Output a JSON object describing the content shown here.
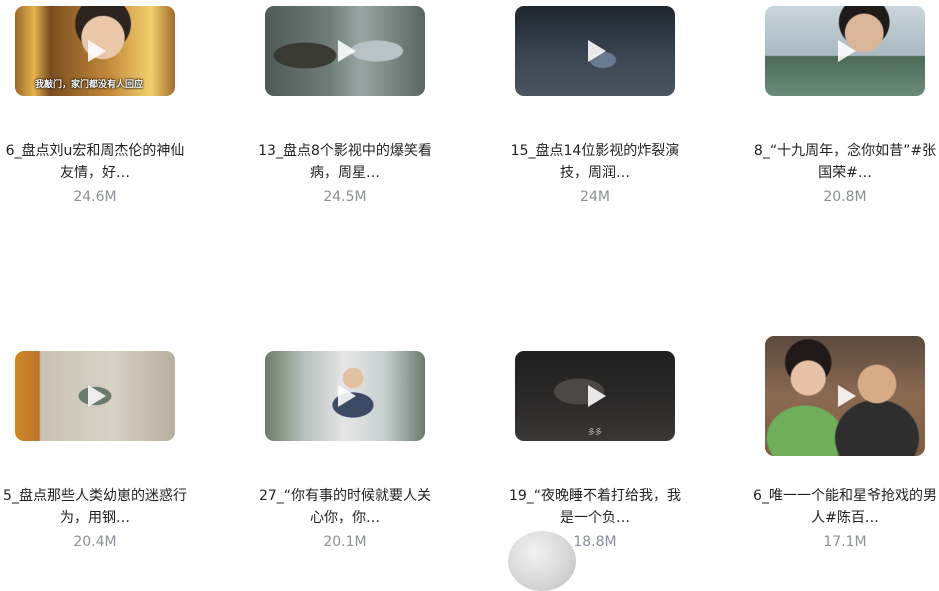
{
  "videos": [
    {
      "title": "6_盘点刘u宏和周杰伦的神仙友情，好…",
      "size": "24.6M",
      "thumb_caption": "我敲门，家门都没有人回应"
    },
    {
      "title": "13_盘点8个影视中的爆笑看病，周星…",
      "size": "24.5M"
    },
    {
      "title": "15_盘点14位影视的炸裂演技，周润…",
      "size": "24M"
    },
    {
      "title": "8_“十九周年，念你如昔”#张国荣#…",
      "size": "20.8M"
    },
    {
      "title": "5_盘点那些人类幼崽的迷惑行为，用钢…",
      "size": "20.4M"
    },
    {
      "title": "27_“你有事的时候就要人关心你，你…",
      "size": "20.1M"
    },
    {
      "title": "19_“夜晚睡不着打给我，我是一个负…",
      "size": "18.8M",
      "thumb_caption": "多多"
    },
    {
      "title": "6_唯一一个能和星爷抢戏的男人#陈百…",
      "size": "17.1M"
    }
  ],
  "icons": {
    "play": "play-icon"
  }
}
